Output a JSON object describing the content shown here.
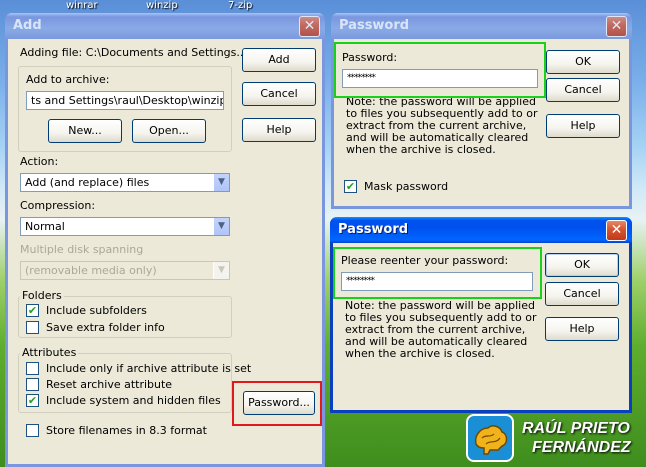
{
  "desktop": {
    "icon_labels": [
      "winrar",
      "winzip",
      "7-zip"
    ]
  },
  "add_dialog": {
    "title": "Add",
    "close_glyph": "✕",
    "adding_file": "Adding file: C:\\Documents and Settings...\\*.*",
    "add_button": "Add",
    "cancel_button": "Cancel",
    "help_button": "Help",
    "add_to_archive_label": "Add to archive:",
    "archive_path": "ts and Settings\\raul\\Desktop\\winzip.zip",
    "new_button": "New...",
    "open_button": "Open...",
    "action_label": "Action:",
    "action_value": "Add (and replace) files",
    "compression_label": "Compression:",
    "compression_value": "Normal",
    "spanning_label": "Multiple disk spanning",
    "spanning_value": "(removable media only)",
    "folders_group": "Folders",
    "include_subfolders": "Include subfolders",
    "include_subfolders_checked": true,
    "save_folder_info": "Save extra folder info",
    "save_folder_info_checked": false,
    "attributes_group": "Attributes",
    "attr_archive_only": "Include only if archive attribute is set",
    "attr_archive_only_checked": false,
    "attr_reset": "Reset archive attribute",
    "attr_reset_checked": false,
    "attr_system_hidden": "Include system and hidden files",
    "attr_system_hidden_checked": true,
    "store_83": "Store filenames in 8.3 format",
    "store_83_checked": false,
    "password_button": "Password...",
    "highlight_color": "#e0191b"
  },
  "password_dialog": {
    "title": "Password",
    "close_glyph": "✕",
    "password_label": "Password:",
    "password_value": "********",
    "ok_button": "OK",
    "cancel_button": "Cancel",
    "help_button": "Help",
    "note": "Note:  the password will be applied to files you subsequently add to or extract from the current archive, and will be automatically cleared when the archive is closed.",
    "mask_password": "Mask password",
    "mask_password_checked": true,
    "highlight_color": "#19d11b"
  },
  "reenter_dialog": {
    "title": "Password",
    "close_glyph": "✕",
    "reenter_label": "Please reenter your password:",
    "password_value": "********",
    "ok_button": "OK",
    "cancel_button": "Cancel",
    "help_button": "Help",
    "note": "Note:  the password will be applied to files you subsequently add to or extract from the current archive, and will be automatically cleared when the archive is closed.",
    "highlight_color": "#19d11b"
  },
  "watermark": {
    "line1": "RAÚL PRIETO",
    "line2": "FERNÁNDEZ",
    "accent": "#1a8fd6"
  },
  "checkmark_glyph": "✔",
  "dropdown_glyph": "▼"
}
